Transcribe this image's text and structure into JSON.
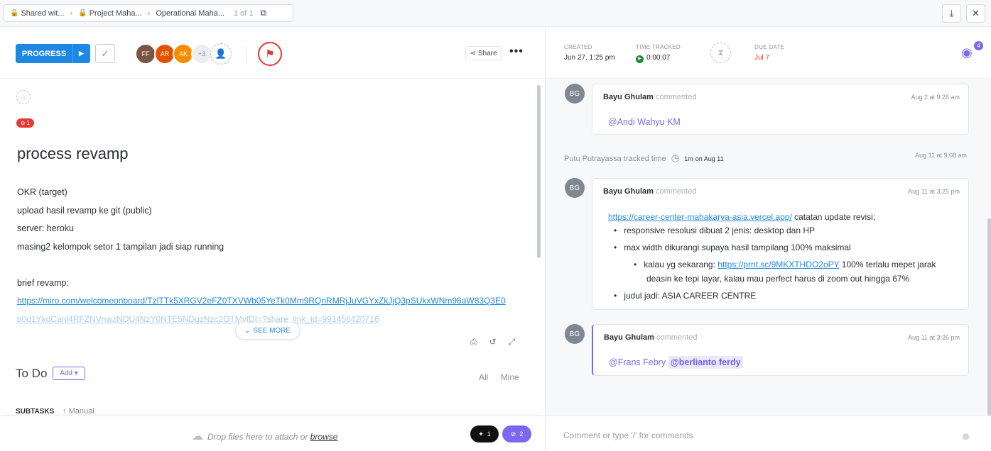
{
  "breadcrumb": {
    "items": [
      "Shared wit...",
      "Project Maha...",
      "Operational Maha..."
    ],
    "count": "1 of 1"
  },
  "topbar": {
    "download_icon": "download-icon",
    "close_icon": "close-icon"
  },
  "toolbar": {
    "status_label": "PROGRESS",
    "avatars": [
      {
        "initials": "FF",
        "color": "#7b5544"
      },
      {
        "initials": "AR",
        "color": "#e65100"
      },
      {
        "initials": "AK",
        "color": "#fb8c00"
      }
    ],
    "extra_assignees": "+3",
    "share_label": "Share",
    "more_label": "•••",
    "flag_color": "#e53935"
  },
  "task": {
    "badge_count": "1",
    "title": "process revamp",
    "description": [
      "OKR (target)",
      "upload hasil revamp ke git (public)",
      "server: heroku",
      "masing2 kelompok setor 1 tampilan jadi siap running",
      "",
      "brief revamp:"
    ],
    "link_line1": "https://miro.com/welcomeonboard/TzlTTk5XRGV2eFZ0TXVWb05YeTk0Mm9RQnRMRjJuVGYxZkJjQ3pSUkxWNm96aW83Q3E0",
    "link_line2": "b0d1YkdCanl4RFZNVnwzNDU4NzY0NTE5NDgzNzc2OTMyfDI=?share_link_id=991456420716",
    "see_more": "SEE MORE"
  },
  "todo": {
    "heading": "To Do",
    "add_label": "Add ▾",
    "filter_all": "All",
    "filter_mine": "Mine",
    "subtasks_label": "SUBTASKS",
    "sort_label": "Manual"
  },
  "dropzone": {
    "text": "Drop files here to attach or ",
    "browse": "browse",
    "figma_count": "1",
    "attach_count": "2"
  },
  "meta": {
    "created_label": "CREATED",
    "created_value": "Jun 27, 1:25 pm",
    "tracked_label": "TIME TRACKED",
    "tracked_value": "0:00:07",
    "due_label": "DUE DATE",
    "due_value": "Jul 7",
    "watchers": "4"
  },
  "activity": {
    "c1": {
      "author": "Bayu Ghulam",
      "verb": "commented",
      "time": "Aug 2 at 9:26 am",
      "mention": "@Andi Wahyu KM"
    },
    "tracked": {
      "user": "Putu Putrayassa",
      "verb": "tracked time",
      "duration": "1m",
      "on": "on Aug 11",
      "time": "Aug 11 at 9:08 am"
    },
    "c2": {
      "author": "Bayu Ghulam",
      "verb": "commented",
      "time": "Aug 11 at 3:25 pm",
      "link": "https://career-center-mahakarya-asia.vercel.app/",
      "after_link": " catatan update revisi:",
      "b1": "responsive resolusi dibuat 2 jenis: desktop dan HP",
      "b2": "max width dikurangi supaya hasil tampilang 100% maksimal",
      "b3_pre": "kalau yg sekarang: ",
      "b3_link": "https://prnt.sc/9MKXTHDO2oPY",
      "b3_post": " 100% terlalu mepet jarak",
      "b3_line2": "deasin ke tepi layar, kalau mau perfect harus di zoom out hingga 67%",
      "b4": "judul jadi: ASIA CAREER CENTRE"
    },
    "c3": {
      "author": "Bayu Ghulam",
      "verb": "commented",
      "time": "Aug 11 at 3:26 pm",
      "mention1": "@Frans Febry",
      "mention2": "@berlianto ferdy"
    }
  },
  "comment_input": {
    "placeholder": "Comment or type '/' for commands"
  }
}
